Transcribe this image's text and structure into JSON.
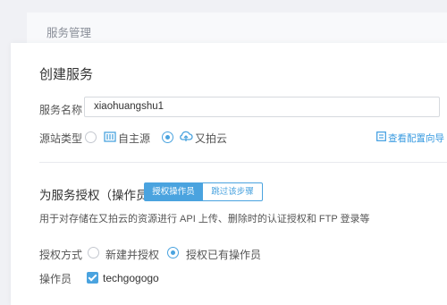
{
  "header": {
    "title": "服务管理"
  },
  "create_service": {
    "heading": "创建服务",
    "name_label": "服务名称",
    "name_value": "xiaohuangshu1",
    "source_type_label": "源站类型",
    "source_options": [
      {
        "label": "自主源",
        "selected": false,
        "icon": "server-icon"
      },
      {
        "label": "又拍云",
        "selected": true,
        "icon": "cloud-icon"
      }
    ],
    "config_guide_link": "查看配置向导",
    "config_guide_icon": "guide-icon"
  },
  "authorization": {
    "heading": "为服务授权（操作员）",
    "tabs": [
      {
        "label": "授权操作员",
        "active": true
      },
      {
        "label": "跳过该步骤",
        "active": false
      }
    ],
    "description": "用于对存储在又拍云的资源进行 API 上传、删除时的认证授权和 FTP 登录等",
    "method_label": "授权方式",
    "method_options": [
      {
        "label": "新建并授权",
        "selected": false
      },
      {
        "label": "授权已有操作员",
        "selected": true
      }
    ],
    "operator_label": "操作员",
    "operator": {
      "name": "techgogogo",
      "checked": true
    }
  },
  "colors": {
    "accent": "#4aa3df",
    "text": "#333333",
    "muted": "#8a8f99"
  }
}
